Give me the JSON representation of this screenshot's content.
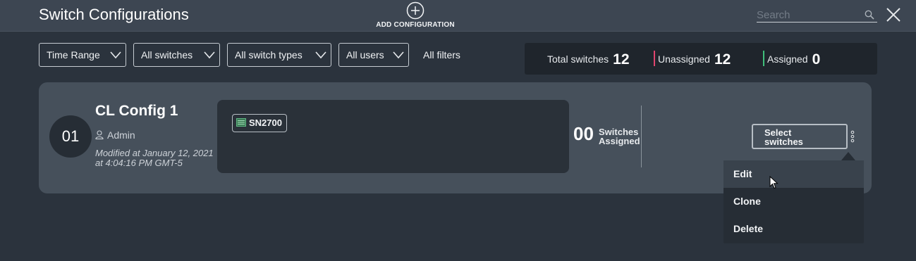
{
  "header": {
    "title": "Switch Configurations",
    "add_label": "ADD CONFIGURATION",
    "add_icon": "plus-circle-icon",
    "search_placeholder": "Search",
    "search_icon": "search-icon",
    "close_icon": "close-icon"
  },
  "filters": [
    {
      "label": "Time Range"
    },
    {
      "label": "All switches"
    },
    {
      "label": "All switch types"
    },
    {
      "label": "All users"
    }
  ],
  "all_filters_label": "All filters",
  "stats": {
    "total_label": "Total switches",
    "total": "12",
    "unassigned_label": "Unassigned",
    "unassigned": "12",
    "unassigned_color": "#e0446e",
    "assigned_label": "Assigned",
    "assigned": "0",
    "assigned_color": "#3fbf7a"
  },
  "config": {
    "number": "01",
    "name": "CL Config 1",
    "owner": "Admin",
    "modified": "Modified at January 12, 2021 at 4:04:16 PM GMT-5",
    "switch_tag": "SN2700",
    "assigned_count": "00",
    "assigned_label_1": "Switches",
    "assigned_label_2": "Assigned",
    "select_label_1": "Select",
    "select_label_2": "switches"
  },
  "menu": {
    "items": [
      {
        "label": "Edit"
      },
      {
        "label": "Clone"
      },
      {
        "label": "Delete"
      }
    ]
  }
}
